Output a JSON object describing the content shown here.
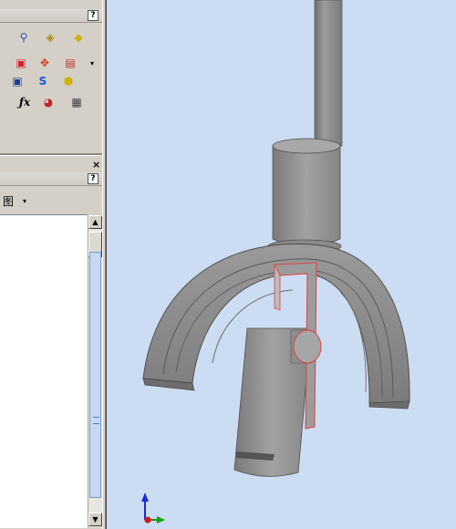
{
  "app": "3D CAD assembly view",
  "panel_top": {
    "help_label": "?",
    "close_label": "×",
    "row1": [
      {
        "icon": "pin-icon",
        "glyph": "⚲",
        "color": "#2a55c0"
      },
      {
        "icon": "bolt-icon",
        "glyph": "♛",
        "color": "#3a6bd0"
      },
      {
        "icon": "component-icon",
        "glyph": "◈",
        "color": "#b08a10"
      },
      {
        "icon": "warning-component-icon",
        "glyph": "◆",
        "color": "#d0b010"
      }
    ],
    "row2": [
      {
        "icon": "insert-part-icon",
        "glyph": "▣",
        "color": "#d02020"
      },
      {
        "icon": "explode-icon",
        "glyph": "✥",
        "color": "#d04020"
      },
      {
        "icon": "pattern-icon",
        "glyph": "▤",
        "color": "#c03030"
      }
    ],
    "row3": [
      {
        "icon": "mate-icon",
        "glyph": "▣",
        "color": "#1a3a9a"
      },
      {
        "icon": "smart-fastener-icon",
        "glyph": "S",
        "color": "#1a5acc"
      },
      {
        "icon": "move-component-icon",
        "glyph": "⬢",
        "color": "#d0b000"
      }
    ],
    "row4": [
      {
        "icon": "equation-icon",
        "glyph": "ƒx",
        "color": "#000000"
      },
      {
        "icon": "color-appearance-icon",
        "glyph": "◕",
        "color": "#c02828"
      },
      {
        "icon": "bill-of-materials-icon",
        "glyph": "▦",
        "color": "#404040"
      }
    ]
  },
  "panel_bottom": {
    "close_label": "×",
    "help_label": "?",
    "view_icon_glyph": "图",
    "dropdown_glyph": "▾"
  },
  "scrollbar": {
    "up": "▲",
    "down": "▼"
  },
  "triad": {
    "z_color": "#1a2ad8",
    "x_color": "#e01010",
    "y_color": "#10a010"
  },
  "model": {
    "body_color": "#8c8c8c",
    "highlight_color": "#e04040"
  }
}
